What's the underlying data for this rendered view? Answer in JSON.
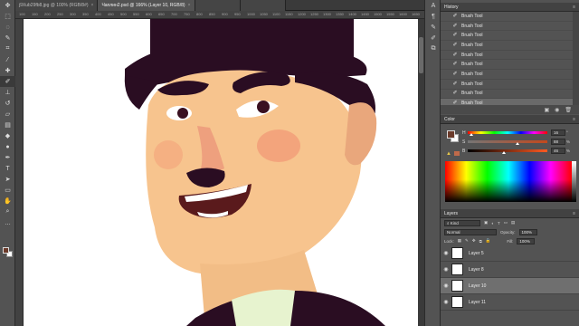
{
  "tabs": [
    {
      "label": "j9Xub29fb8.jpg @ 100% (RGB/8#)",
      "active": false
    },
    {
      "label": "Чаплин2.psd @ 166% (Layer 10, RGB/8)",
      "active": true
    },
    {
      "label": "",
      "active": false
    },
    {
      "label": "",
      "active": false
    }
  ],
  "ruler_ticks": [
    "100",
    "150",
    "200",
    "250",
    "300",
    "350",
    "400",
    "450",
    "500",
    "550",
    "600",
    "650",
    "700",
    "750",
    "800",
    "850",
    "900",
    "950",
    "1000",
    "1050",
    "1100",
    "1150",
    "1200",
    "1250",
    "1300",
    "1350",
    "1400",
    "1450",
    "1500",
    "1550",
    "1600",
    "1650",
    "1700"
  ],
  "history": {
    "title": "History",
    "menu": "≡",
    "items": [
      "Brush Tool",
      "Brush Tool",
      "Brush Tool",
      "Brush Tool",
      "Brush Tool",
      "Brush Tool",
      "Brush Tool",
      "Brush Tool",
      "Brush Tool",
      "Brush Tool"
    ],
    "selected_index": 9
  },
  "color": {
    "title": "Color",
    "foreground": "#6b3a2a",
    "background": "#ffffff",
    "h": {
      "key": "H",
      "value": "16",
      "unit": "°",
      "level": 0.05
    },
    "s": {
      "key": "S",
      "value": "88",
      "unit": "%",
      "level": 0.63
    },
    "b": {
      "key": "B",
      "value": "46",
      "unit": "%",
      "level": 0.46
    }
  },
  "layers": {
    "title": "Layers",
    "kind_label": "Kind",
    "blend_mode": "Normal",
    "opacity_label": "Opacity:",
    "opacity_value": "100%",
    "lock_label": "Lock:",
    "fill_label": "Fill:",
    "fill_value": "100%",
    "items": [
      {
        "name": "Layer 5",
        "selected": false
      },
      {
        "name": "Layer 8",
        "selected": false
      },
      {
        "name": "Layer 10",
        "selected": true
      },
      {
        "name": "Layer 11",
        "selected": false
      }
    ]
  }
}
